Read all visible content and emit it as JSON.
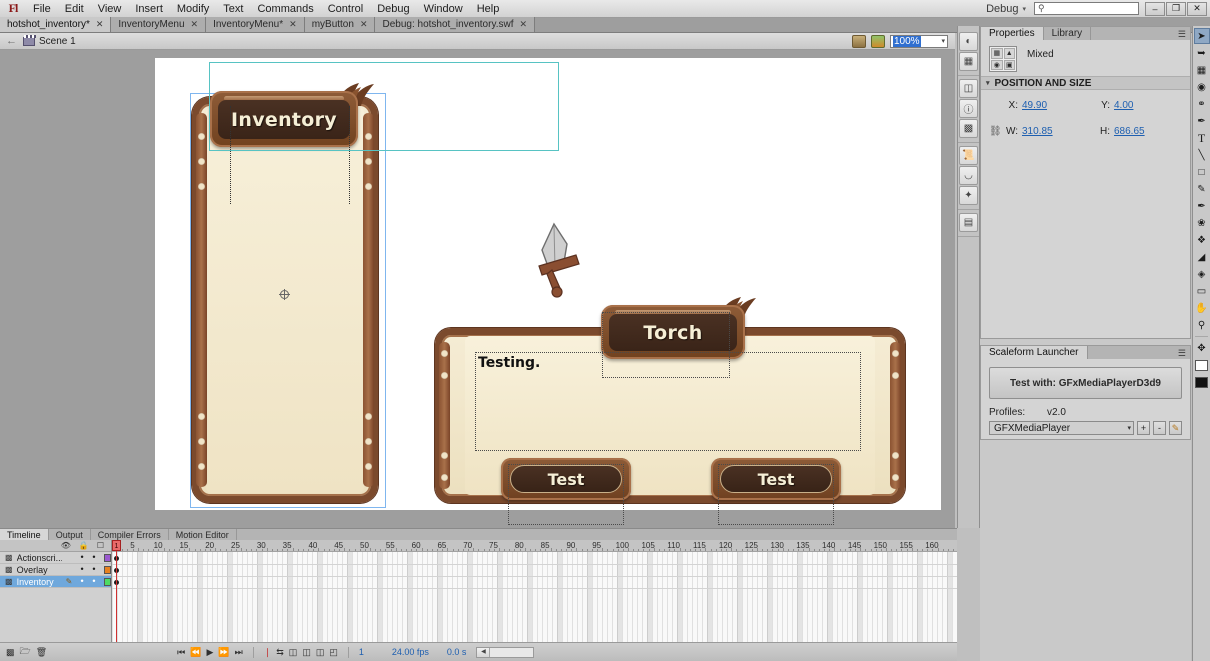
{
  "app": {
    "logo": "Fl",
    "menus": [
      "File",
      "Edit",
      "View",
      "Insert",
      "Modify",
      "Text",
      "Commands",
      "Control",
      "Debug",
      "Window",
      "Help"
    ],
    "workspace": "Debug",
    "search_placeholder": "",
    "window_buttons": {
      "minimize": "–",
      "restore": "❐",
      "close": "✕"
    }
  },
  "doc_tabs": [
    {
      "label": "hotshot_inventory*",
      "close": "✕",
      "active": true
    },
    {
      "label": "InventoryMenu",
      "close": "✕",
      "active": false
    },
    {
      "label": "InventoryMenu*",
      "close": "✕",
      "active": false
    },
    {
      "label": "myButton",
      "close": "✕",
      "active": false
    },
    {
      "label": "Debug: hotshot_inventory.swf",
      "close": "✕",
      "active": false
    }
  ],
  "scene_bar": {
    "back_arrow": "←",
    "scene_label": "Scene 1",
    "zoom_value": "100%",
    "zoom_caret": "▾"
  },
  "stage": {
    "inventory_panel_title": "Inventory",
    "detail_panel_title": "Torch",
    "body_text": "Testing.",
    "button_left_label": "Test",
    "button_right_label": "Test",
    "sword_icon": "sword-icon"
  },
  "properties_panel": {
    "tabs": [
      {
        "label": "Properties",
        "active": true
      },
      {
        "label": "Library",
        "active": false
      }
    ],
    "panel_menu_icon": "panel-menu-icon",
    "symbol_type": "Mixed",
    "section_title": "POSITION AND SIZE",
    "fields": [
      {
        "label": "X:",
        "value": "49.90"
      },
      {
        "label": "Y:",
        "value": "4.00"
      },
      {
        "label": "W:",
        "value": "310.85"
      },
      {
        "label": "H:",
        "value": "686.65"
      }
    ]
  },
  "scaleform_panel": {
    "tab_label": "Scaleform Launcher",
    "panel_menu_icon": "panel-menu-icon",
    "test_button_label": "Test with: GFxMediaPlayerD3d9",
    "profiles_label": "Profiles:",
    "version": "v2.0",
    "profile_selected": "GFXMediaPlayer",
    "combo_caret": "▾",
    "add_button": "+",
    "remove_button": "-",
    "edit_button": "✎"
  },
  "timeline": {
    "tabs": [
      {
        "label": "Timeline",
        "active": true
      },
      {
        "label": "Output",
        "active": false
      },
      {
        "label": "Compiler Errors",
        "active": false
      },
      {
        "label": "Motion Editor",
        "active": false
      }
    ],
    "column_icons": [
      "eye-icon",
      "lock-icon",
      "outline-icon"
    ],
    "layers": [
      {
        "name": "Actionscri...",
        "color": "#9b59d0",
        "selected": false,
        "locked_dot": "•",
        "vis_dot": "•",
        "pencil": ""
      },
      {
        "name": "Overlay",
        "color": "#e8811f",
        "selected": false,
        "locked_dot": "•",
        "vis_dot": "•",
        "pencil": ""
      },
      {
        "name": "Inventory",
        "color": "#4ddb63",
        "selected": true,
        "locked_dot": "•",
        "vis_dot": "•",
        "pencil": "✎"
      }
    ],
    "ruler_ticks": [
      1,
      5,
      10,
      15,
      20,
      25,
      30,
      35,
      40,
      45,
      50,
      55,
      60,
      65,
      70,
      75,
      80,
      85,
      90,
      95,
      100,
      105,
      110,
      115,
      120,
      125,
      130,
      135,
      140,
      145,
      150,
      155,
      160
    ],
    "ruler_last_partial": "16",
    "current_frame_marker": "1",
    "footer": {
      "new_layer_icon": "new-layer-icon",
      "new_folder_icon": "new-folder-icon",
      "delete_icon": "trash-icon",
      "go_start": "⏮",
      "step_back": "⏪",
      "play": "▶",
      "step_fwd": "⏩",
      "go_end": "⏭",
      "center_playhead_icon": "center-playhead-icon",
      "loop_icon": "loop-icon",
      "onion_icons": [
        "onion-1",
        "onion-2",
        "onion-3",
        "onion-edit"
      ],
      "frame_number": "1",
      "fps": "24.00 fps",
      "elapsed": "0.0 s",
      "scroll_arrow": "◀"
    }
  },
  "icon_dock": {
    "groups": [
      [
        "color-swatch-icon",
        "align-icon"
      ],
      [
        "scene-icon",
        "info-icon",
        "transform-icon"
      ],
      [
        "script-icon",
        "components-icon",
        "behaviors-icon"
      ],
      [
        "movie-explorer-icon"
      ]
    ]
  },
  "tools_panel": {
    "tools": [
      "selection-tool",
      "subselection-tool",
      "free-transform-tool",
      "lasso-tool",
      "lasso-poly-tool",
      "pen-tool",
      "text-tool",
      "line-tool",
      "rectangle-tool",
      "pencil-tool",
      "brush-tool",
      "deco-tool",
      "bone-tool",
      "paint-bucket-tool",
      "ink-bottle-tool",
      "eraser-tool",
      "hand-tool",
      "zoom-tool",
      "eyedropper-tool",
      "stroke-color-swatch",
      "fill-color-swatch"
    ],
    "selected": "selection-tool"
  },
  "colors": {
    "accent_blue": "#1e5fb0",
    "selection_cyan": "#57c3c3",
    "selection_blue": "#7fb6ef",
    "playhead_red": "#d03030",
    "panel_wood": "#7b4a2d",
    "panel_parchment": "#f5ecd4",
    "plate_dark": "#3a2418"
  }
}
